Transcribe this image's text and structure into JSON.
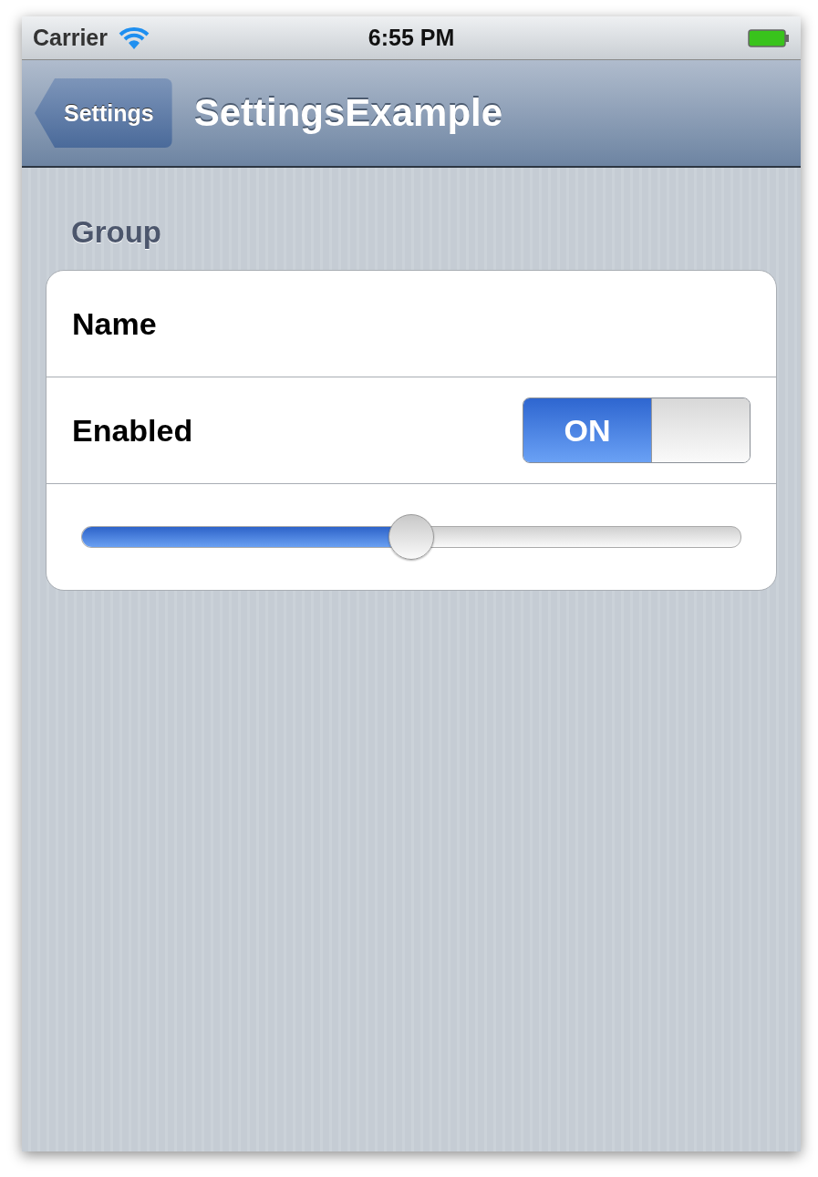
{
  "status_bar": {
    "carrier": "Carrier",
    "time": "6:55 PM"
  },
  "nav_bar": {
    "back_button": "Settings",
    "title": "SettingsExample"
  },
  "group": {
    "header": "Group",
    "rows": [
      {
        "kind": "text",
        "label": "Name"
      },
      {
        "kind": "toggle",
        "label": "Enabled",
        "on": true,
        "switch_label": "ON"
      },
      {
        "kind": "slider",
        "level": 0.5
      }
    ]
  }
}
